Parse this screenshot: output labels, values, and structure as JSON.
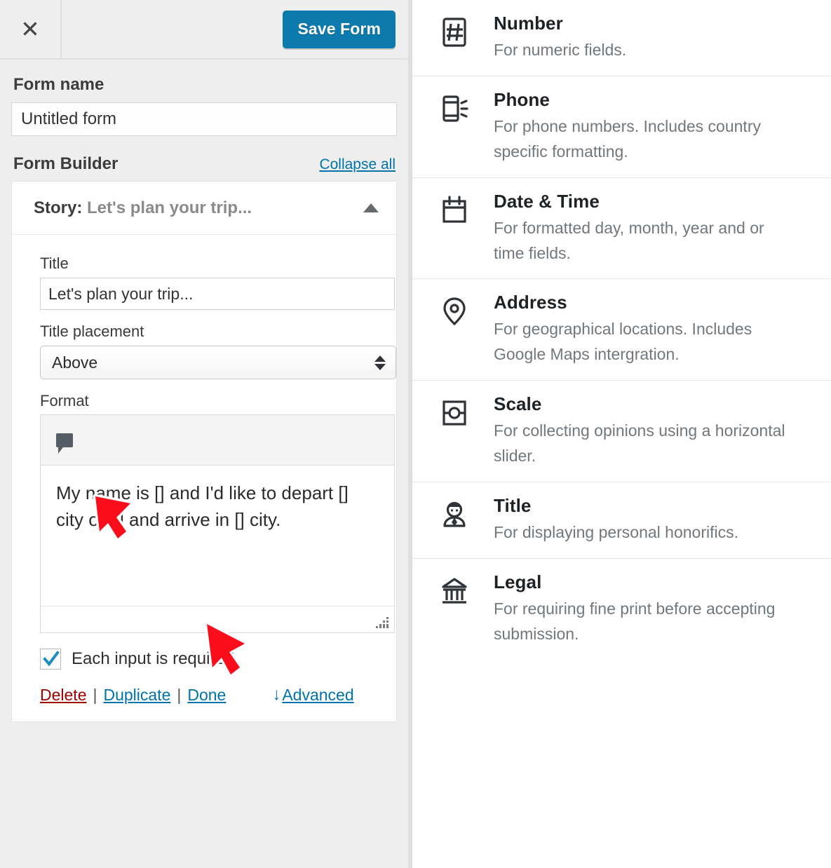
{
  "topbar": {
    "close_icon": "close-icon",
    "save_label": "Save Form",
    "accent_color": "#0c7aad"
  },
  "form": {
    "name_label": "Form name",
    "name_value": "Untitled form",
    "name_placeholder": "Untitled form"
  },
  "builder": {
    "title": "Form Builder",
    "collapse_all": "Collapse all",
    "field": {
      "header_type": "Story:",
      "header_title": "Let's plan your trip...",
      "collapse_icon": "chevron-up-icon",
      "title_label": "Title",
      "title_value": "Let's plan your trip...",
      "placement_label": "Title placement",
      "placement_value": "Above",
      "format_label": "Format",
      "toolbar_icon": "comment-bubble-icon",
      "format_value": "My name is [] and I'd like to depart [] city on [] and arrive in [] city.",
      "required_label": "Each input is required",
      "required_checked": true,
      "actions": {
        "delete": "Delete",
        "separator": "|",
        "duplicate": "Duplicate",
        "done": "Done",
        "advanced": "Advanced",
        "advanced_icon": "arrow-down-icon"
      }
    }
  },
  "field_types": [
    {
      "icon": "number-icon",
      "name": "Number",
      "desc": "For numeric fields."
    },
    {
      "icon": "phone-icon",
      "name": "Phone",
      "desc": "For phone numbers. Includes country specific formatting."
    },
    {
      "icon": "calendar-icon",
      "name": "Date & Time",
      "desc": "For formatted day, month, year and or time fields."
    },
    {
      "icon": "map-pin-icon",
      "name": "Address",
      "desc": "For geographical locations. Includes Google Maps intergration."
    },
    {
      "icon": "scale-slider-icon",
      "name": "Scale",
      "desc": "For collecting opinions using a horizontal slider."
    },
    {
      "icon": "person-title-icon",
      "name": "Title",
      "desc": "For displaying personal honorifics."
    },
    {
      "icon": "bank-legal-icon",
      "name": "Legal",
      "desc": "For requiring fine print before accepting submission."
    }
  ],
  "annotations": {
    "pointer_1": "red-cursor-arrow",
    "pointer_2": "red-cursor-arrow"
  }
}
